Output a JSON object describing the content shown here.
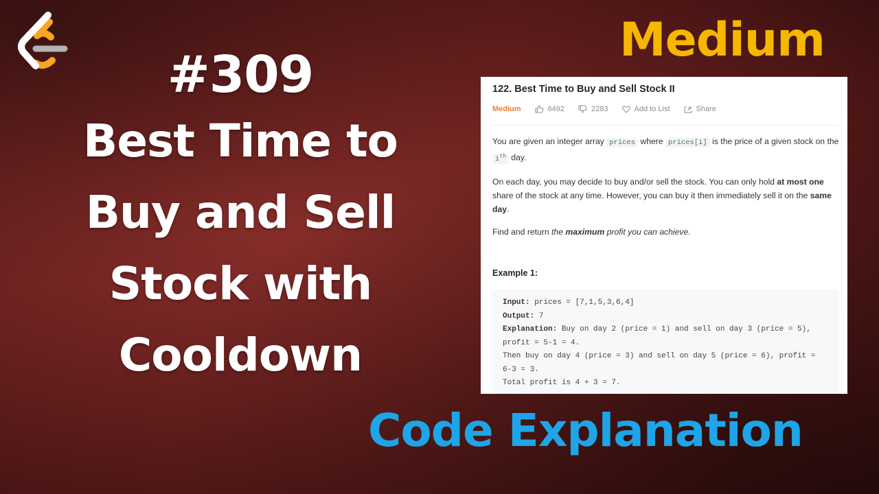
{
  "thumbnail": {
    "logo": "leetcode-logo-icon",
    "problem_number": "#309",
    "title_lines": [
      "Best Time to",
      "Buy and Sell",
      "Stock with",
      "Cooldown"
    ],
    "difficulty_label": "Medium",
    "footer_label": "Code Explanation",
    "colors": {
      "difficulty": "#f5b700",
      "footer": "#1ea5e8",
      "title": "#ffffff",
      "background": "#6e2220"
    }
  },
  "panel": {
    "title": "122. Best Time to Buy and Sell Stock II",
    "difficulty": "Medium",
    "likes": "6492",
    "dislikes": "2283",
    "add_to_list": "Add to List",
    "share": "Share",
    "description": {
      "p1_a": "You are given an integer array ",
      "p1_code1": "prices",
      "p1_b": " where ",
      "p1_code2": "prices[i]",
      "p1_c": " is the price of a given stock on the ",
      "p1_code3": "i",
      "p1_sup": "th",
      "p1_d": " day.",
      "p2_a": "On each day, you may decide to buy and/or sell the stock. You can only hold ",
      "p2_b": "at most one",
      "p2_c": " share of the stock at any time. However, you can buy it then immediately sell it on the ",
      "p2_d": "same day",
      "p2_e": ".",
      "p3_a": "Find and return ",
      "p3_b": "the ",
      "p3_c": "maximum",
      "p3_d": " profit you can achieve."
    },
    "example_heading": "Example 1:",
    "example": {
      "input_label": "Input:",
      "input_value": " prices = [7,1,5,3,6,4]",
      "output_label": "Output:",
      "output_value": " 7",
      "explanation_label": "Explanation:",
      "explanation_lines": [
        " Buy on day 2 (price = 1) and sell on day 3 (price = 5),",
        "profit = 5-1 = 4.",
        "Then buy on day 4 (price = 3) and sell on day 5 (price = 6), profit =",
        "6-3 = 3.",
        "Total profit is 4 + 3 = 7."
      ]
    }
  }
}
